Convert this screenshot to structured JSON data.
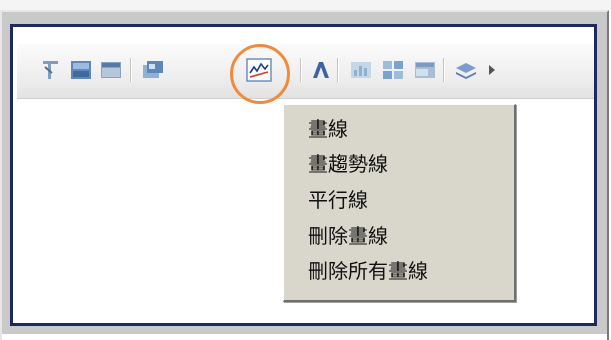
{
  "toolbar": {
    "buttons": [
      {
        "name": "cursor-select-icon",
        "color": "#6b8fb8"
      },
      {
        "name": "chart-window-icon",
        "color": "#4f7fb5"
      },
      {
        "name": "window-tile-icon",
        "color": "#6a85b0"
      },
      {
        "name": "chart-options-icon",
        "color": "#7a9ac2"
      },
      {
        "name": "draw-line-icon",
        "color": "#c0392b",
        "selected": true
      },
      {
        "name": "text-annotation-icon",
        "color": "#4468a6"
      },
      {
        "name": "indicator-chart-icon",
        "color": "#9eb7d2"
      },
      {
        "name": "multi-chart-icon",
        "color": "#8fb0cf"
      },
      {
        "name": "chart-panel-icon",
        "color": "#9cb2cc"
      },
      {
        "name": "layers-icon",
        "color": "#6d8dc0"
      },
      {
        "name": "more-arrow-icon",
        "color": "#555555"
      }
    ],
    "highlight_color": "#f28a3c"
  },
  "menu": {
    "items": [
      {
        "label": "畫線"
      },
      {
        "label": "畫趨勢線"
      },
      {
        "label": "平行線"
      },
      {
        "label": "刪除畫線"
      },
      {
        "label": "刪除所有畫線"
      }
    ],
    "background": "#d9d7cc"
  },
  "frame": {
    "border_color": "#1c2a5c"
  }
}
